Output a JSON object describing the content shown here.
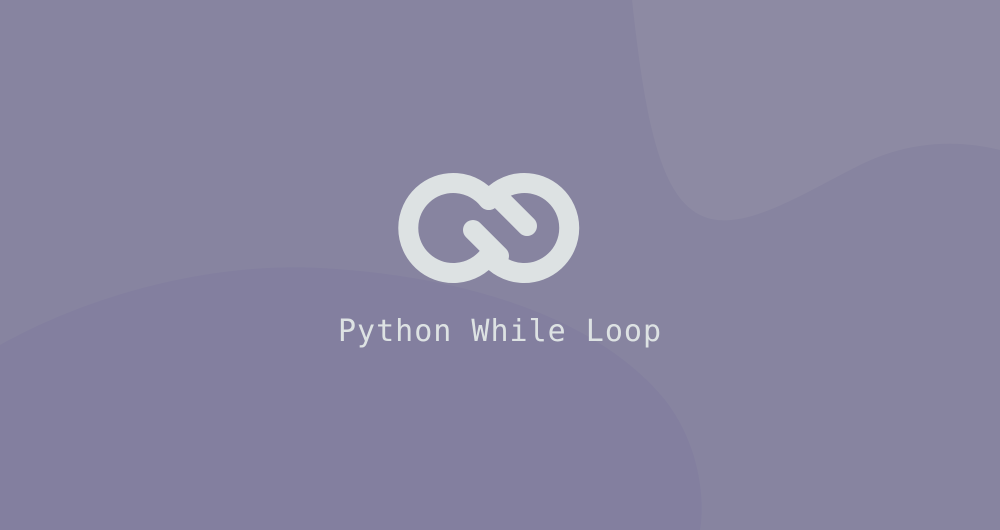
{
  "banner": {
    "title": "Python While Loop",
    "icon": "infinity-loop-icon",
    "colors": {
      "background": "#8784a0",
      "accent_top_right": "#8d8aa3",
      "accent_bottom_left": "#837f9f",
      "foreground": "#dde2e3"
    }
  }
}
